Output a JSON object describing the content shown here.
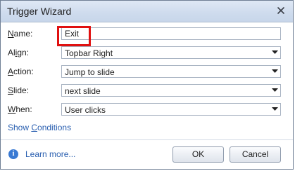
{
  "window": {
    "title": "Trigger Wizard",
    "close_glyph": "✕"
  },
  "form": {
    "name": {
      "label_prefix": "",
      "label_access": "N",
      "label_rest": "ame:",
      "value": "Exit"
    },
    "align": {
      "label_prefix": "Al",
      "label_access": "i",
      "label_rest": "gn:",
      "value": "Topbar Right"
    },
    "action": {
      "label_prefix": "",
      "label_access": "A",
      "label_rest": "ction:",
      "value": "Jump to slide"
    },
    "slide": {
      "label_prefix": "",
      "label_access": "S",
      "label_rest": "lide:",
      "value": "next slide"
    },
    "when": {
      "label_prefix": "",
      "label_access": "W",
      "label_rest": "hen:",
      "value": "User clicks"
    }
  },
  "show_conditions": {
    "prefix": "Show ",
    "access": "C",
    "rest": "onditions"
  },
  "footer": {
    "learn_more": "Learn more...",
    "ok_label": "OK",
    "cancel_label": "Cancel"
  },
  "icons": {
    "info": "info-icon",
    "close": "close-icon",
    "dropdown": "chevron-down-icon"
  },
  "colors": {
    "highlight": "#e01010",
    "link": "#2a5fb0",
    "info": "#3a7ad3"
  }
}
